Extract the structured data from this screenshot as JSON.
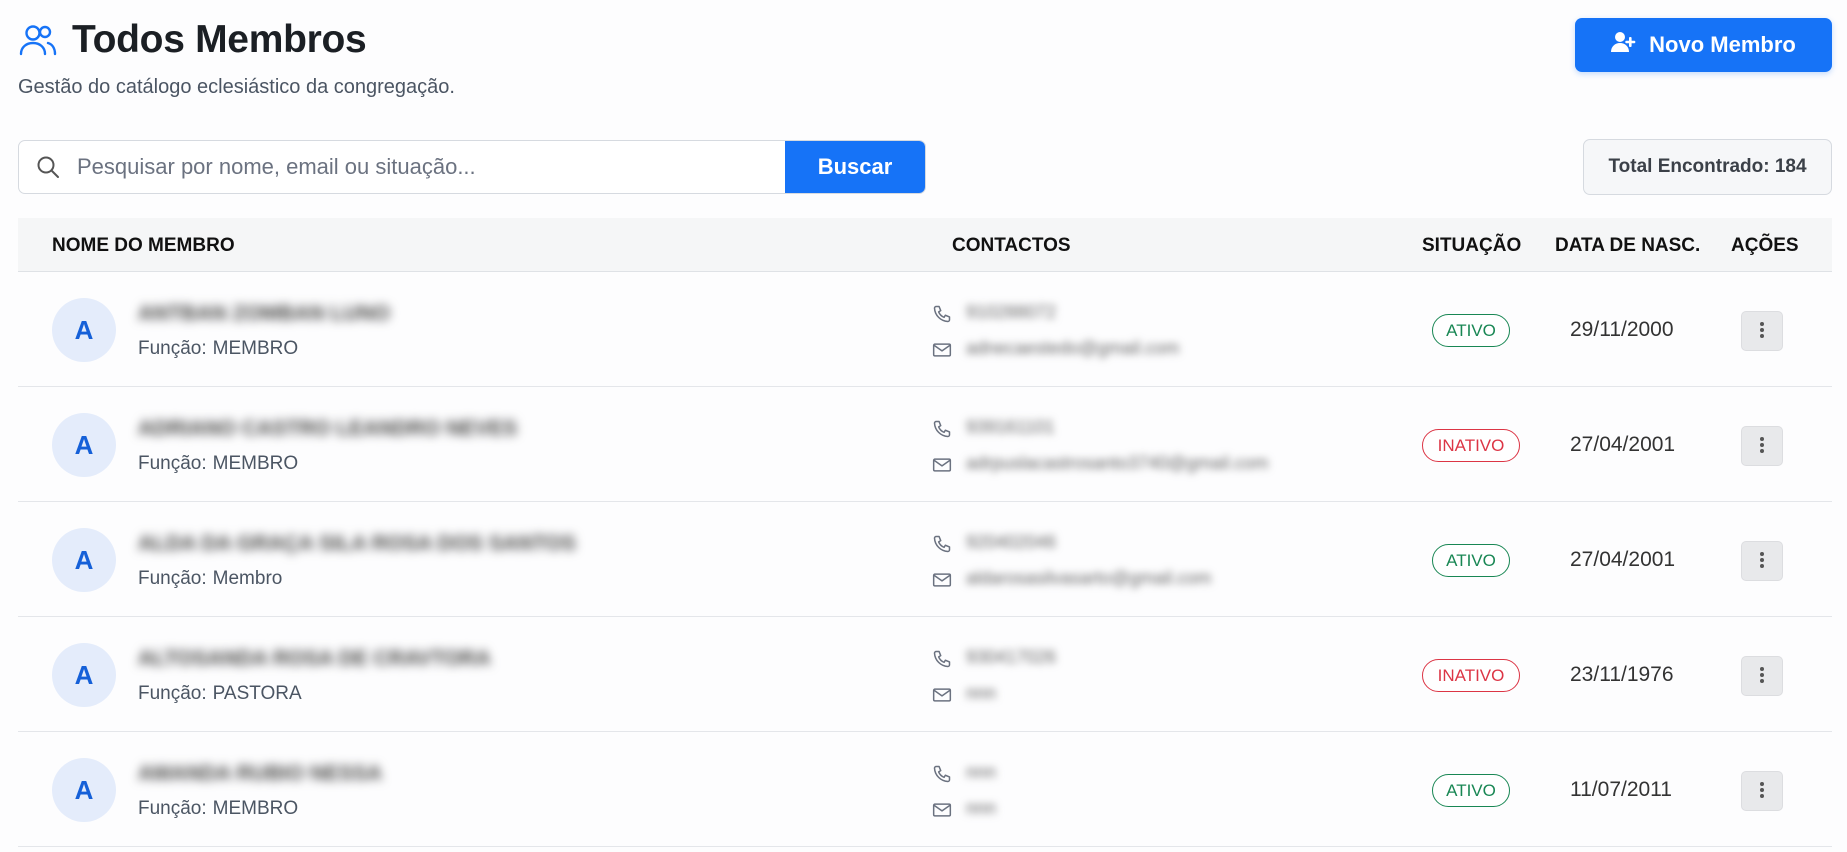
{
  "header": {
    "title": "Todos Membros",
    "subtitle": "Gestão do catálogo eclesiástico da congregação.",
    "title_icon": "users-icon"
  },
  "new_member_button": {
    "label": "Novo Membro",
    "icon": "user-plus-icon"
  },
  "search": {
    "placeholder": "Pesquisar por nome, email ou situação...",
    "value": "",
    "button_label": "Buscar"
  },
  "total": "Total Encontrado: 184",
  "table": {
    "headers": {
      "name": "Nome do Membro",
      "contacts": "Contactos",
      "status": "Situação",
      "birth_date": "Data de Nasc.",
      "actions": "Ações"
    },
    "role_label": "Função:",
    "rows": [
      {
        "initial": "A",
        "name": "ANTBAN ZOMBAN LUNO",
        "role": "MEMBRO",
        "phone": "910288072",
        "email": "adnecaestedo@gmail.com",
        "status": "ATIVO",
        "status_key": "ativo",
        "birth_date": "29/11/2000"
      },
      {
        "initial": "A",
        "name": "ADRIANO CASTRO LEANDRO NEVES",
        "role": "MEMBRO",
        "phone": "939161101",
        "email": "adrpuslacastrosanto3740@gmail.com",
        "status": "INATIVO",
        "status_key": "inativo",
        "birth_date": "27/04/2001"
      },
      {
        "initial": "A",
        "name": "ALDA DA GRAÇA SILA ROSA DOS SANTOS",
        "role": "Membro",
        "phone": "920402046",
        "email": "aldarosasilvasarto@gmail.com",
        "status": "ATIVO",
        "status_key": "ativo",
        "birth_date": "27/04/2001"
      },
      {
        "initial": "A",
        "name": "ALTOSANDA ROSA DE CRAVTORA",
        "role": "PASTORA",
        "phone": "930417026",
        "email": "nnn",
        "status": "INATIVO",
        "status_key": "inativo",
        "birth_date": "23/11/1976"
      },
      {
        "initial": "A",
        "name": "AMANDA RUBIO NESSA",
        "role": "MEMBRO",
        "phone": "nnn",
        "email": "nnn",
        "status": "ATIVO",
        "status_key": "ativo",
        "birth_date": "11/07/2011"
      }
    ]
  },
  "colors": {
    "primary": "#1673f7",
    "active": "#198754",
    "inactive": "#dc3545",
    "avatar_bg": "#e4ecfb"
  }
}
